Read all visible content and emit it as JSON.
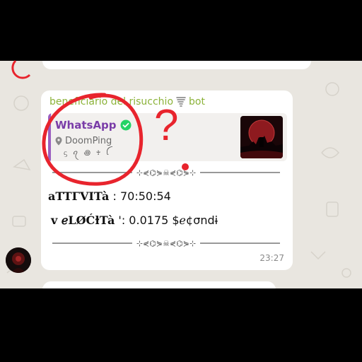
{
  "message": {
    "sender": "beneficiario del risucchio",
    "sender_suffix": "bot",
    "sender_emoji_icon": "tornado-icon",
    "preview": {
      "title": "WhatsApp",
      "subtitle": "DoomPing",
      "glyph_line": "ᦓ ꪖ ꩜ ♰ ꪶ"
    },
    "divider": "⊹⋞⌬⋟☠⋞⌬⋟⊹",
    "uptime": {
      "label": "aTTΓV​ITà",
      "value": ": 70:50:54"
    },
    "velocity": {
      "label": "v ℯLØĆɫTà",
      "value": "': 0.0175 $ℯ¢σndɨ"
    },
    "time": "23:27"
  },
  "colors": {
    "chat_background": "#e9e6e0",
    "bubble": "#ffffff",
    "sender_name": "#8cb33a",
    "preview_title": "#7a3da8",
    "verified_badge": "#25d366",
    "annotation_red": "#e8242d"
  },
  "annotation": {
    "mark": "?"
  }
}
